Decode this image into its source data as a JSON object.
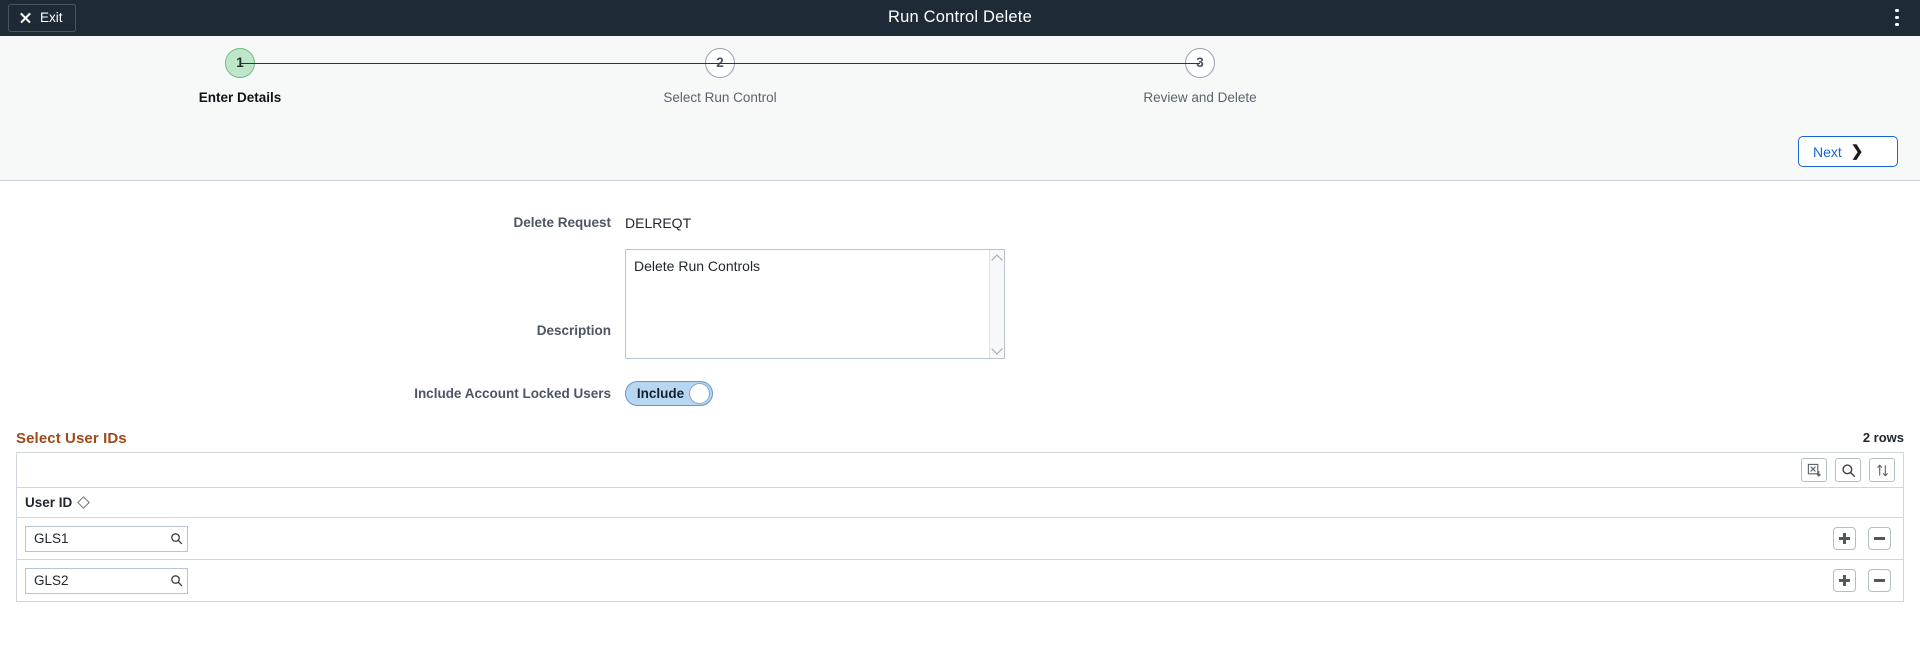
{
  "topbar": {
    "exit_label": "Exit",
    "exit_icon": "close-x-icon",
    "title": "Run Control Delete",
    "menu_icon": "kebab-menu-icon",
    "background": "#1f2a37"
  },
  "wizard": {
    "steps": [
      {
        "number": "1",
        "label": "Enter Details",
        "active": true
      },
      {
        "number": "2",
        "label": "Select Run Control",
        "active": false
      },
      {
        "number": "3",
        "label": "Review and Delete",
        "active": false
      }
    ],
    "active_color": "#bfe6c8",
    "next_label": "Next",
    "next_icon": "chevron-right-icon",
    "next_accent": "#1565d8"
  },
  "form": {
    "delete_request": {
      "label": "Delete Request",
      "value": "DELREQT"
    },
    "description": {
      "label": "Description",
      "value": "Delete Run Controls",
      "placeholder": "",
      "scroll_up_icon": "chevron-up-icon",
      "scroll_down_icon": "chevron-down-icon"
    },
    "include_locked": {
      "label": "Include Account Locked Users",
      "toggle_text": "Include",
      "state": "on",
      "accent": "#b6d6f2"
    }
  },
  "grid": {
    "title": "Select User IDs",
    "title_color": "#9e4a1a",
    "rows_count": "2 rows",
    "toolbar": [
      {
        "name": "download-excel-icon",
        "title": "Download to Excel"
      },
      {
        "name": "search-icon",
        "title": "Find"
      },
      {
        "name": "sort-updown-icon",
        "title": "Sort"
      }
    ],
    "columns": [
      {
        "label": "User ID",
        "sort_icon": "sort-diamond-icon"
      }
    ],
    "rows": [
      {
        "user_id": "GLS1",
        "lookup_icon": "search-icon",
        "add_icon": "plus-icon",
        "remove_icon": "minus-icon"
      },
      {
        "user_id": "GLS2",
        "lookup_icon": "search-icon",
        "add_icon": "plus-icon",
        "remove_icon": "minus-icon"
      }
    ]
  }
}
